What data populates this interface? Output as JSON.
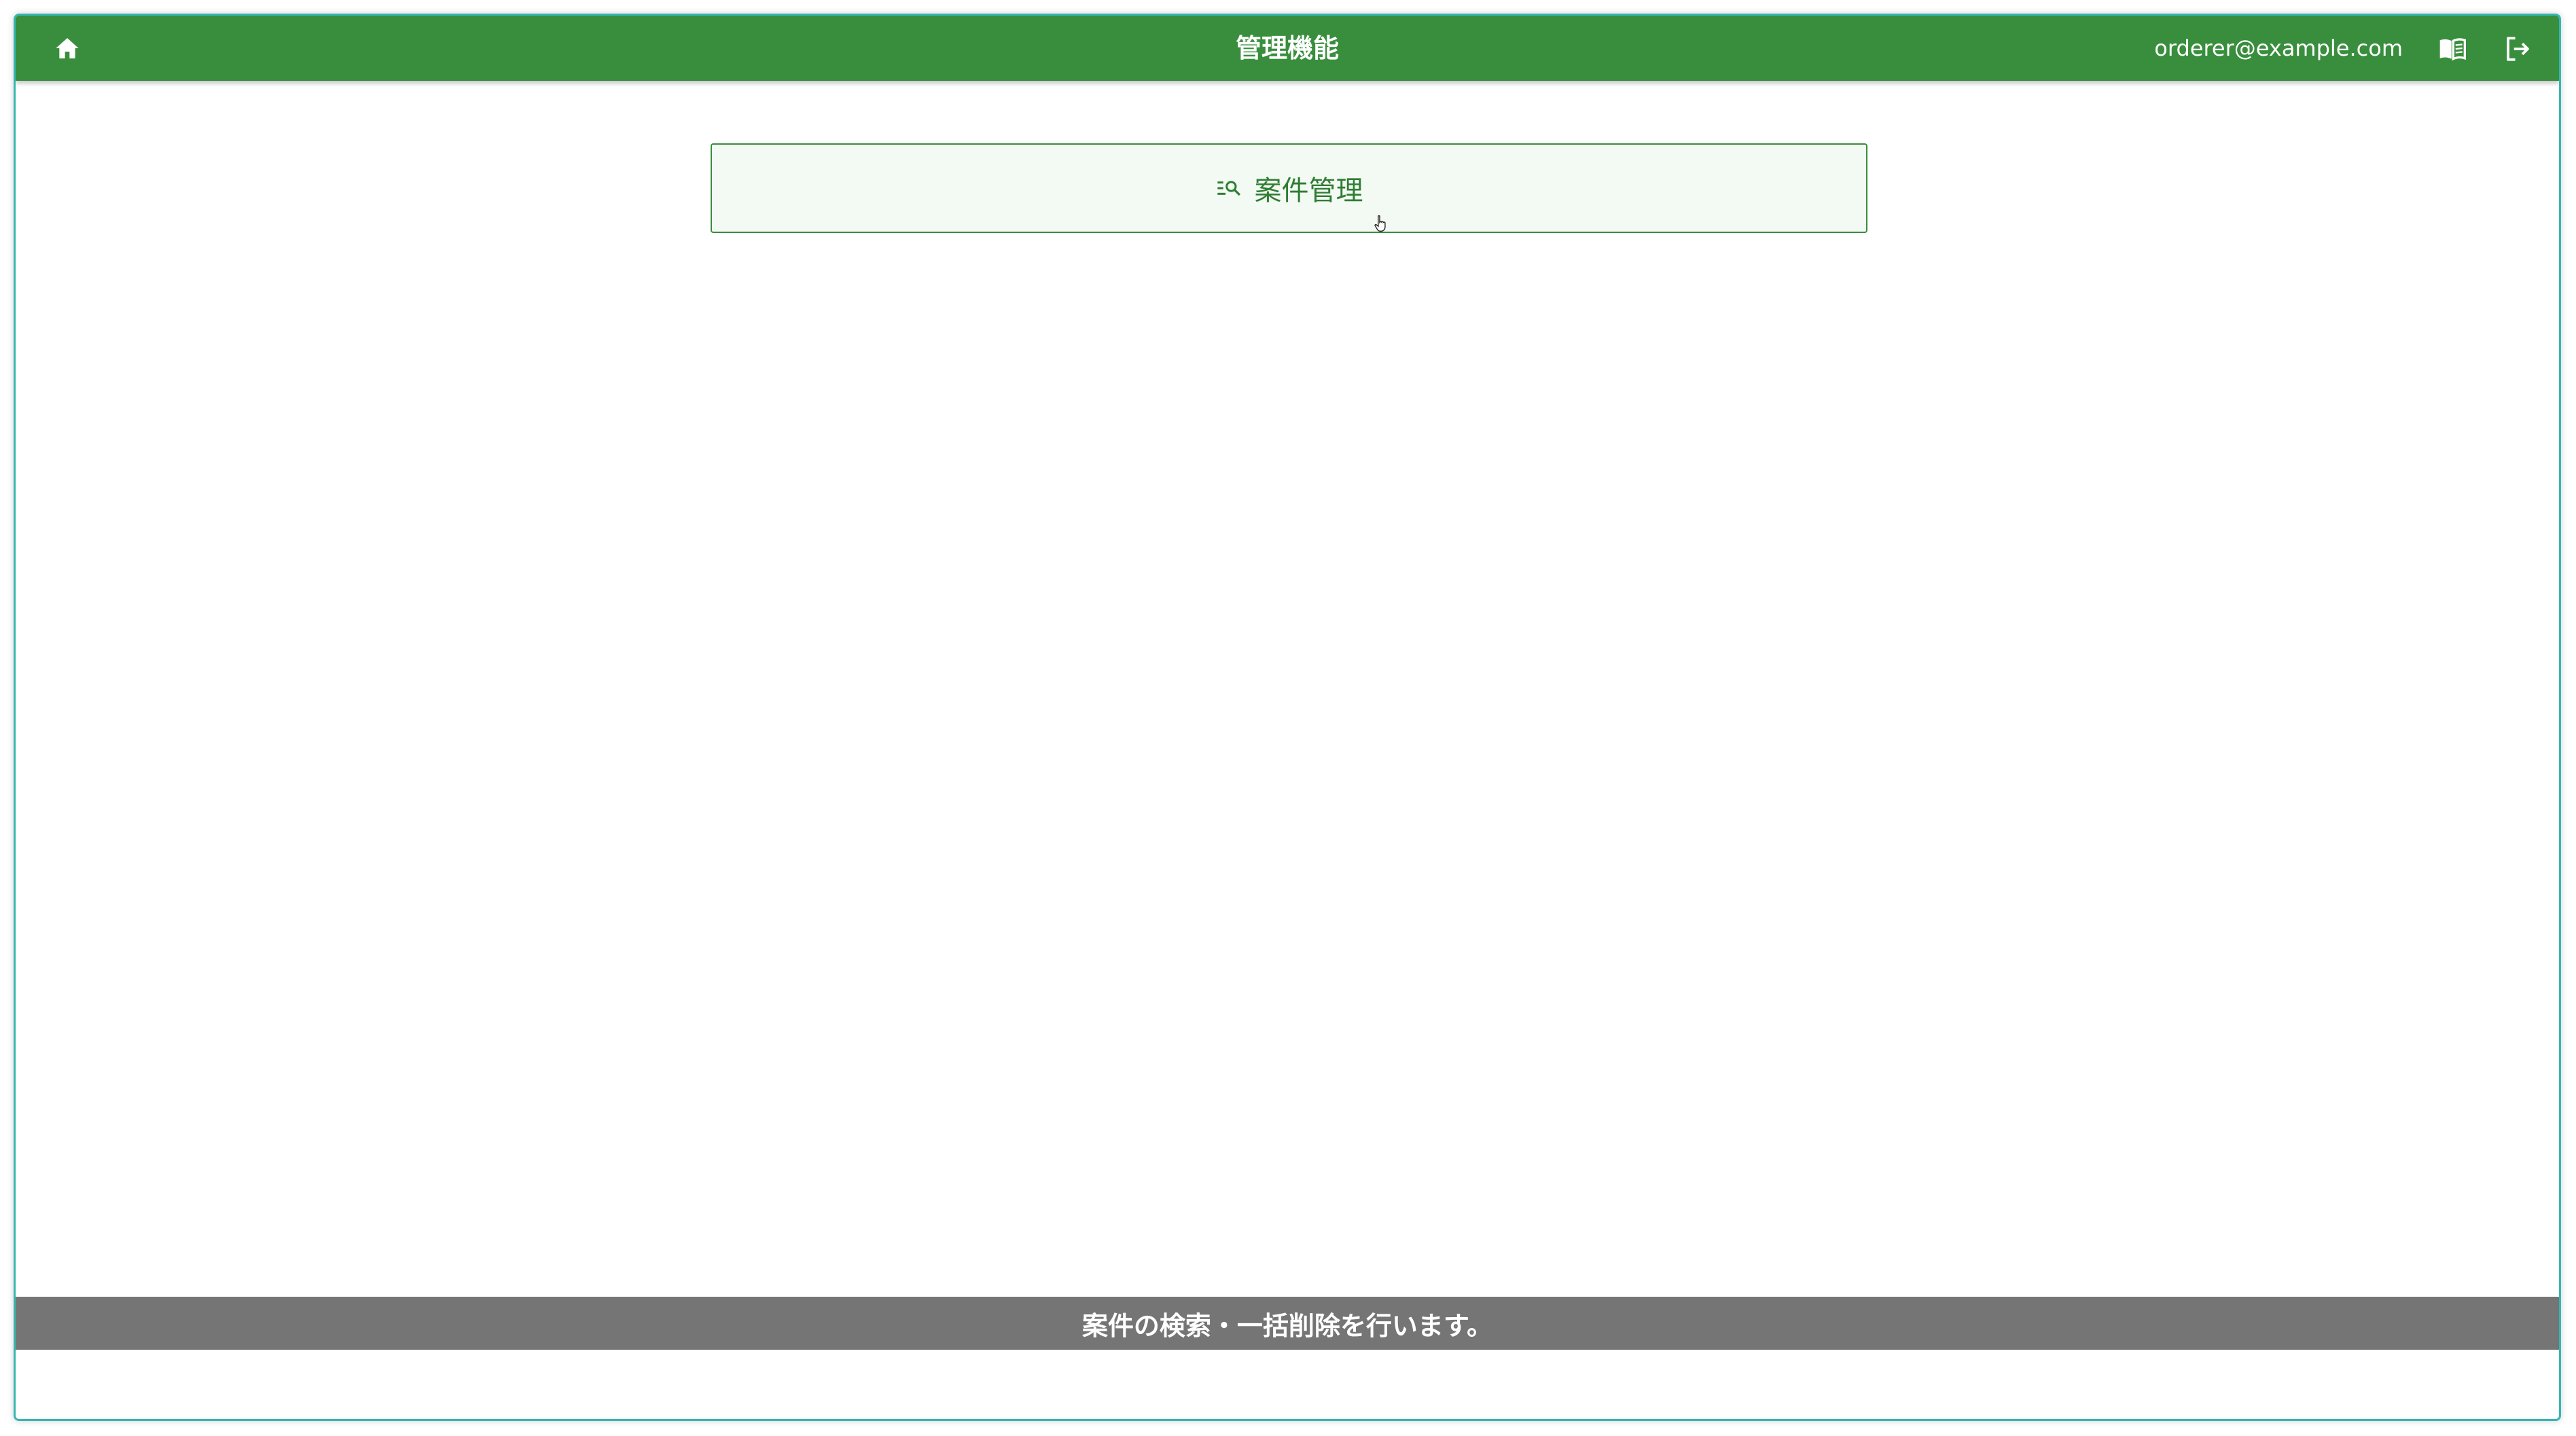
{
  "header": {
    "title": "管理機能",
    "user_email": "orderer@example.com",
    "home_icon": "home-icon",
    "manual_icon": "book-icon",
    "logout_icon": "logout-icon"
  },
  "main": {
    "menu_items": [
      {
        "label": "案件管理",
        "icon": "search-list-icon"
      }
    ]
  },
  "status_bar": {
    "message": "案件の検索・一括削除を行います。"
  },
  "colors": {
    "header_bg": "#388e3c",
    "accent": "#2e7d32",
    "button_bg": "#f3f9f3",
    "status_bg": "#757575",
    "window_border": "#35b7b3"
  }
}
